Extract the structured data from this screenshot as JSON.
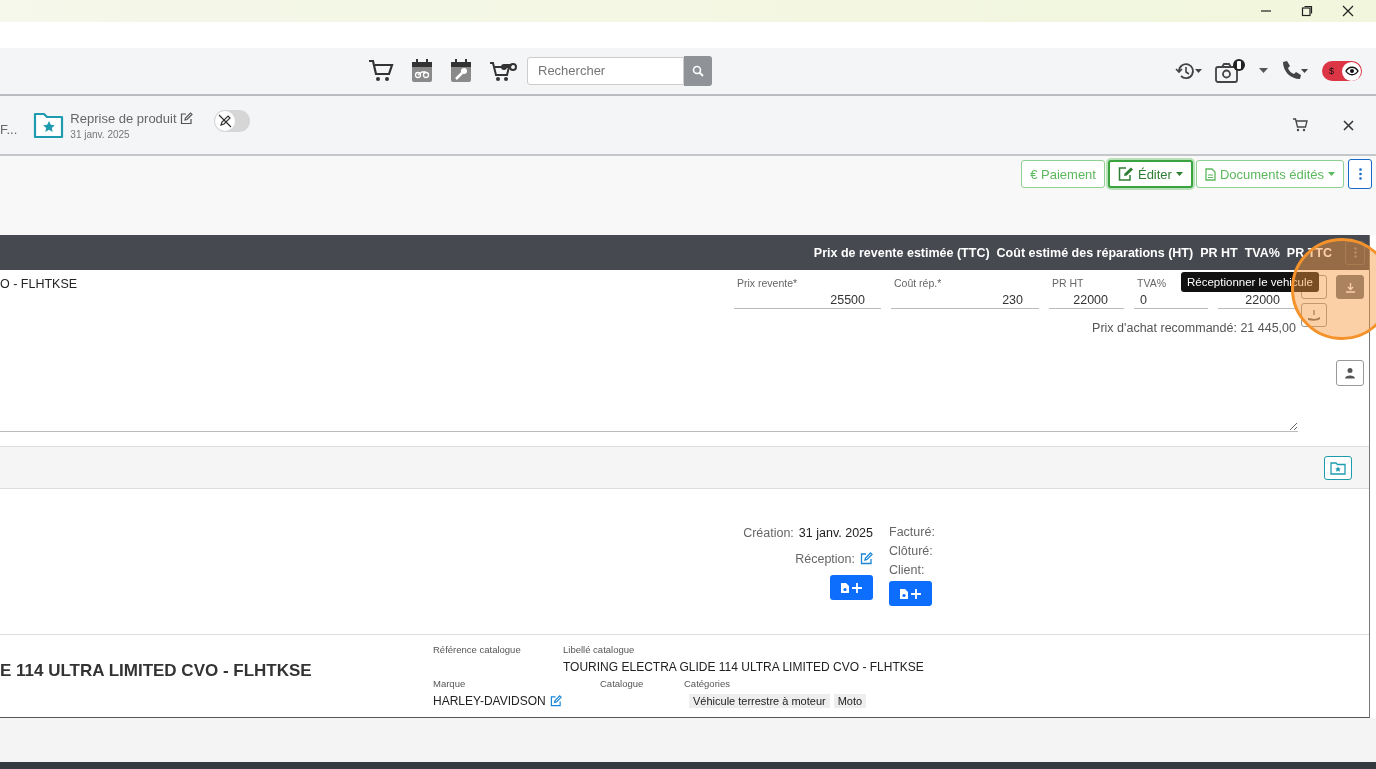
{
  "nav": {
    "search": {
      "placeholder": "Rechercher"
    },
    "currency_toggle": {
      "label": "$",
      "on": true
    }
  },
  "tab_bar": {
    "truncated_tab": "F...",
    "document": {
      "title": "Reprise de produit",
      "date": "31 janv. 2025"
    },
    "lock_toggle": {
      "on": false
    }
  },
  "actions": [
    {
      "label": "€ Paiement",
      "kind": "plain",
      "focused": false
    },
    {
      "label": "Éditer",
      "kind": "edit",
      "focused": true
    },
    {
      "label": "Documents édités",
      "kind": "documents",
      "focused": false
    }
  ],
  "table": {
    "columns": [
      "Prix de revente estimée (TTC)",
      "Coût estimé des réparations (HT)",
      "PR HT",
      "TVA%",
      "PR TTC"
    ],
    "row": {
      "title": "O - FLHTKSE",
      "fields": [
        {
          "label": "Prix revente*",
          "value": "25500",
          "kind": "amount"
        },
        {
          "label": "Coût rép.*",
          "value": "230",
          "kind": "amount"
        },
        {
          "label": "PR HT",
          "value": "22000",
          "kind": "amount"
        },
        {
          "label": "TVA%",
          "value": "0",
          "kind": "percent"
        },
        {
          "value": "22000",
          "kind": "amount"
        }
      ],
      "recommended": "Prix d'achat recommandé: 21 445,00"
    },
    "tooltip": "Réceptionner le vehicule"
  },
  "dates": {
    "created_label": "Création:",
    "created": "31 janv. 2025",
    "reception_label": "Réception:",
    "right": [
      "Facturé:",
      "Clôturé:",
      "Client:"
    ]
  },
  "vehicle": {
    "title": "E 114 ULTRA LIMITED CVO - FLHTKSE",
    "catalog_ref": {
      "label": "Référence catalogue"
    },
    "catalog_label": {
      "label": "Libellé catalogue",
      "value": "TOURING ELECTRA GLIDE 114 ULTRA LIMITED CVO - FLHTKSE"
    },
    "brand": {
      "label": "Marque",
      "value": "HARLEY-DAVIDSON"
    },
    "catalog": {
      "label": "Catalogue"
    },
    "categories": {
      "label": "Catégories",
      "tags": [
        "Véhicule terrestre à moteur",
        "Moto"
      ]
    }
  }
}
